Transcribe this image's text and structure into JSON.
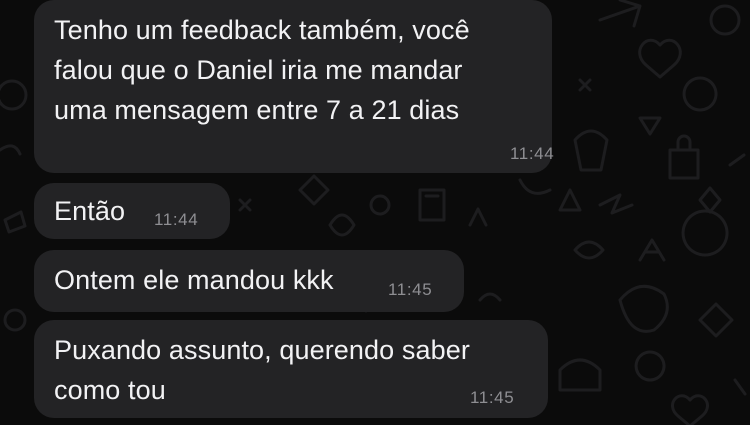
{
  "messages": [
    {
      "text": "Tenho um feedback também, você\nfalou que o Daniel iria me mandar\numa mensagem entre 7 a 21 dias",
      "time": "11:44"
    },
    {
      "text": "Então",
      "time": "11:44"
    },
    {
      "text": "Ontem ele mandou kkk",
      "time": "11:45"
    },
    {
      "text": "Puxando assunto, querendo saber\ncomo tou",
      "time": "11:45"
    }
  ],
  "theme": {
    "background": "#0b0b0b",
    "bubble_color": "#232325",
    "text_color": "#f2f2f4",
    "time_color": "#8e8e92"
  }
}
